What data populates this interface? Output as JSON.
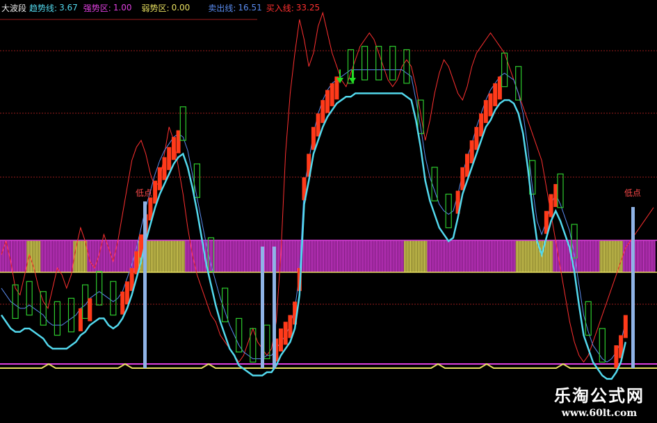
{
  "legend": {
    "title": "大波段",
    "trend_label": "趋势线:",
    "trend_value": "3.67",
    "strong_label": "强势区:",
    "strong_value": "1.00",
    "weak_label": "弱势区:",
    "weak_value": "0.00",
    "sell_label": "卖出线:",
    "sell_value": "16.51",
    "buy_label": "买入线:",
    "buy_value": "33.25"
  },
  "colors": {
    "background": "#000000",
    "title": "#e8e8e8",
    "trend": "#53d9ee",
    "strong": "#e040e0",
    "weak": "#e8e060",
    "sell": "#5a8cf0",
    "buy": "#ff3030",
    "rising_candle": "#ff3a1a",
    "hollow_candle": "#2ecc2e",
    "grid": "#9b1d1d",
    "signal_bar": "#8fb3e6",
    "annotation": "#ff4a4a",
    "arrow": "#22dd22"
  },
  "annotations": [
    "低点",
    "低点"
  ],
  "watermark": {
    "title": "乐淘公式网",
    "url": "www.60lt.com"
  },
  "chart_data": {
    "type": "line",
    "title": "大波段",
    "series": [
      {
        "name": "趋势线",
        "last_value": 3.67
      },
      {
        "name": "强势区",
        "last_value": 1.0
      },
      {
        "name": "弱势区",
        "last_value": 0.0
      },
      {
        "name": "卖出线",
        "last_value": 16.51
      },
      {
        "name": "买入线",
        "last_value": 33.25
      }
    ],
    "x": [
      0,
      1,
      2,
      3,
      4,
      5,
      6,
      7,
      8,
      9,
      10,
      11,
      12,
      13,
      14,
      15,
      16,
      17,
      18,
      19,
      20,
      21,
      22,
      23,
      24,
      25,
      26,
      27,
      28,
      29,
      30,
      31,
      32,
      33,
      34,
      35,
      36,
      37,
      38,
      39,
      40,
      41,
      42,
      43,
      44,
      45,
      46,
      47,
      48,
      49,
      50,
      51,
      52,
      53,
      54,
      55,
      56,
      57,
      58,
      59,
      60,
      61,
      62,
      63,
      64,
      65,
      66,
      67,
      68,
      69,
      70,
      71,
      72,
      73,
      74,
      75,
      76,
      77,
      78,
      79,
      80,
      81,
      82,
      83,
      84,
      85,
      86,
      87,
      88,
      89,
      90,
      91,
      92,
      93,
      94,
      95,
      96,
      97,
      98,
      99,
      100,
      101,
      102,
      103,
      104,
      105,
      106,
      107,
      108,
      109,
      110,
      111,
      112,
      113,
      114,
      115,
      116,
      117,
      118,
      119,
      120,
      121,
      122,
      123,
      124,
      125,
      126,
      127,
      128,
      129,
      130,
      131,
      132,
      133,
      134,
      135,
      136,
      137,
      138,
      139,
      140
    ],
    "trend_line": [
      22,
      20,
      18,
      17,
      17,
      18,
      18,
      17,
      16,
      15,
      13,
      12,
      12,
      12,
      12,
      13,
      14,
      16,
      17,
      19,
      20,
      21,
      21,
      19,
      18,
      19,
      21,
      24,
      28,
      33,
      38,
      44,
      49,
      54,
      58,
      61,
      64,
      67,
      69,
      70,
      66,
      60,
      53,
      45,
      37,
      31,
      25,
      20,
      16,
      12,
      10,
      7,
      6,
      5,
      4,
      4,
      4,
      5,
      5,
      7,
      10,
      12,
      14,
      18,
      28,
      55,
      62,
      70,
      74,
      78,
      81,
      83,
      85,
      86,
      87,
      87,
      88,
      88,
      88,
      88,
      88,
      88,
      88,
      88,
      88,
      88,
      88,
      87,
      86,
      80,
      72,
      62,
      56,
      52,
      48,
      46,
      44,
      45,
      51,
      58,
      62,
      66,
      70,
      74,
      78,
      80,
      83,
      85,
      86,
      86,
      85,
      82,
      76,
      66,
      54,
      44,
      40,
      45,
      50,
      53,
      50,
      46,
      42,
      35,
      25,
      16,
      12,
      8,
      6,
      4,
      3,
      3,
      5,
      8,
      14
    ],
    "sell_line": [
      30,
      28,
      26,
      25,
      24,
      24,
      25,
      24,
      23,
      22,
      20,
      19,
      19,
      19,
      20,
      21,
      22,
      24,
      25,
      27,
      28,
      29,
      28,
      27,
      26,
      27,
      29,
      33,
      37,
      42,
      48,
      54,
      59,
      64,
      68,
      71,
      73,
      75,
      76,
      75,
      71,
      64,
      57,
      50,
      43,
      37,
      32,
      27,
      23,
      19,
      16,
      13,
      11,
      10,
      9,
      9,
      9,
      10,
      10,
      12,
      14,
      16,
      19,
      24,
      34,
      60,
      68,
      76,
      82,
      86,
      89,
      91,
      92,
      93,
      94,
      95,
      95,
      95,
      95,
      95,
      95,
      95,
      95,
      95,
      95,
      95,
      95,
      94,
      93,
      86,
      78,
      69,
      63,
      59,
      55,
      53,
      52,
      53,
      58,
      64,
      69,
      73,
      78,
      82,
      86,
      89,
      91,
      93,
      94,
      93,
      92,
      88,
      82,
      72,
      60,
      50,
      46,
      50,
      55,
      58,
      55,
      51,
      47,
      40,
      31,
      22,
      17,
      13,
      11,
      9,
      8,
      9,
      11,
      14,
      20
    ],
    "buy_line": [
      40,
      44,
      38,
      30,
      28,
      34,
      40,
      36,
      30,
      26,
      24,
      30,
      36,
      34,
      30,
      34,
      42,
      48,
      44,
      38,
      36,
      40,
      46,
      42,
      38,
      44,
      52,
      60,
      68,
      72,
      74,
      70,
      64,
      60,
      62,
      70,
      78,
      74,
      66,
      58,
      48,
      40,
      34,
      30,
      26,
      22,
      20,
      16,
      14,
      12,
      10,
      8,
      10,
      14,
      18,
      14,
      12,
      10,
      12,
      20,
      40,
      70,
      88,
      100,
      110,
      104,
      96,
      100,
      108,
      112,
      106,
      100,
      96,
      92,
      90,
      94,
      98,
      102,
      104,
      106,
      104,
      100,
      96,
      92,
      90,
      92,
      96,
      98,
      96,
      90,
      82,
      74,
      80,
      88,
      94,
      98,
      96,
      92,
      88,
      86,
      90,
      96,
      100,
      102,
      104,
      106,
      104,
      102,
      100,
      96,
      92,
      88,
      84,
      80,
      76,
      72,
      68,
      60,
      52,
      44,
      36,
      28,
      20,
      14,
      10,
      8,
      10,
      14,
      18,
      22,
      26,
      30,
      34,
      38,
      42,
      44,
      46,
      48,
      50,
      52,
      54
    ],
    "strong_zone": [
      1,
      1,
      1,
      1,
      1,
      1,
      0,
      0,
      0,
      1,
      1,
      1,
      1,
      1,
      1,
      1,
      0,
      0,
      0,
      1,
      1,
      1,
      1,
      1,
      1,
      1,
      1,
      1,
      1,
      1,
      0,
      0,
      0,
      0,
      0,
      0,
      0,
      0,
      0,
      0,
      1,
      1,
      1,
      1,
      1,
      1,
      1,
      1,
      1,
      1,
      1,
      1,
      1,
      1,
      1,
      1,
      1,
      1,
      1,
      1,
      1,
      1,
      1,
      1,
      1,
      1,
      1,
      1,
      1,
      1,
      1,
      1,
      1,
      1,
      1,
      1,
      1,
      1,
      1,
      1,
      1,
      1,
      1,
      1,
      1,
      1,
      1,
      0,
      0,
      0,
      0,
      0,
      1,
      1,
      1,
      1,
      1,
      1,
      1,
      1,
      1,
      1,
      1,
      1,
      1,
      1,
      1,
      1,
      1,
      1,
      1,
      0,
      0,
      0,
      0,
      0,
      0,
      0,
      0,
      1,
      1,
      1,
      1,
      1,
      1,
      1,
      1,
      1,
      1,
      0,
      0,
      0,
      0,
      0,
      1,
      1,
      1,
      1,
      1,
      1,
      1
    ],
    "ylim": [
      0,
      110
    ]
  }
}
